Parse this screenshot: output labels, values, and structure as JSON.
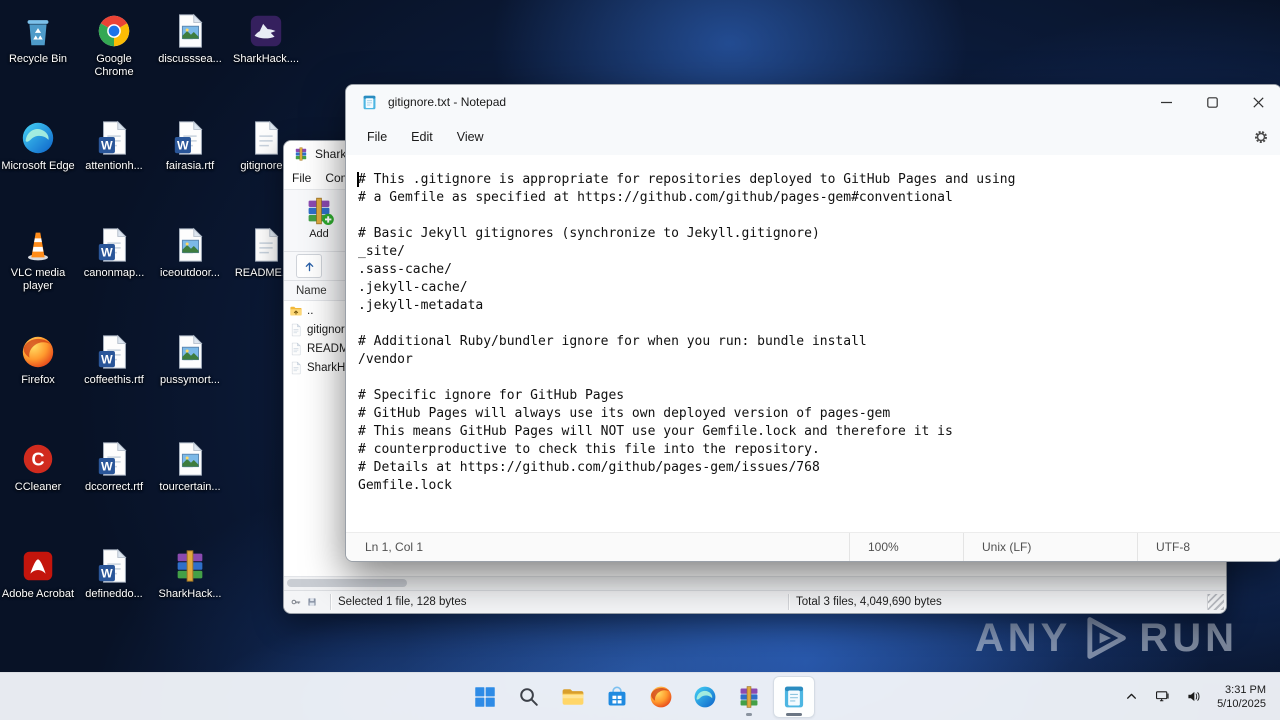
{
  "desktop": {
    "icons": [
      {
        "label": "Recycle Bin",
        "icon": "recycle-bin"
      },
      {
        "label": "Microsoft Edge",
        "icon": "edge-browser"
      },
      {
        "label": "VLC media player",
        "icon": "vlc-cone"
      },
      {
        "label": "Firefox",
        "icon": "firefox-browser"
      },
      {
        "label": "CCleaner",
        "icon": "ccleaner"
      },
      {
        "label": "Adobe Acrobat",
        "icon": "adobe-acrobat"
      },
      {
        "label": "Google Chrome",
        "icon": "chrome-browser"
      },
      {
        "label": "attentionh...",
        "icon": "word-document"
      },
      {
        "label": "canonmap...",
        "icon": "word-document"
      },
      {
        "label": "coffeethis.rtf",
        "icon": "word-document"
      },
      {
        "label": "dccorrect.rtf",
        "icon": "word-document"
      },
      {
        "label": "defineddo...",
        "icon": "word-document"
      },
      {
        "label": "discusssea...",
        "icon": "image-file"
      },
      {
        "label": "fairasia.rtf",
        "icon": "word-document"
      },
      {
        "label": "iceoutdoor...",
        "icon": "image-file"
      },
      {
        "label": "pussymort...",
        "icon": "image-file"
      },
      {
        "label": "tourcertain...",
        "icon": "image-file"
      },
      {
        "label": "SharkHack...",
        "icon": "winrar-archive"
      },
      {
        "label": "SharkHack....",
        "icon": "sharkhack-app"
      },
      {
        "label": "gitignore...",
        "icon": "text-file"
      },
      {
        "label": "README.r...",
        "icon": "text-file"
      }
    ]
  },
  "winrar_window": {
    "title": "SharkHack...",
    "menu": [
      "File",
      "Commands"
    ],
    "toolbar": {
      "add_label": "Add"
    },
    "column_header": "Name",
    "items": [
      {
        "name": "..",
        "icon": "folder-up"
      },
      {
        "name": "gitignore...",
        "icon": "text-file"
      },
      {
        "name": "README...",
        "icon": "text-file"
      },
      {
        "name": "SharkHack...",
        "icon": "text-file"
      }
    ],
    "status": {
      "selected": "Selected 1 file, 128 bytes",
      "total": "Total 3 files, 4,049,690 bytes"
    }
  },
  "notepad": {
    "title": "gitignore.txt - Notepad",
    "menu": [
      "File",
      "Edit",
      "View"
    ],
    "text": "# This .gitignore is appropriate for repositories deployed to GitHub Pages and using\n# a Gemfile as specified at https://github.com/github/pages-gem#conventional\n\n# Basic Jekyll gitignores (synchronize to Jekyll.gitignore)\n_site/\n.sass-cache/\n.jekyll-cache/\n.jekyll-metadata\n\n# Additional Ruby/bundler ignore for when you run: bundle install\n/vendor\n\n# Specific ignore for GitHub Pages\n# GitHub Pages will always use its own deployed version of pages-gem\n# This means GitHub Pages will NOT use your Gemfile.lock and therefore it is\n# counterproductive to check this file into the repository.\n# Details at https://github.com/github/pages-gem/issues/768\nGemfile.lock",
    "status": {
      "position": "Ln 1, Col 1",
      "zoom": "100%",
      "line_ending": "Unix (LF)",
      "encoding": "UTF-8"
    }
  },
  "taskbar": {
    "clock": {
      "time": "3:31 PM",
      "date": "5/10/2025"
    }
  },
  "watermark": {
    "left": "ANY",
    "right": "RUN"
  }
}
